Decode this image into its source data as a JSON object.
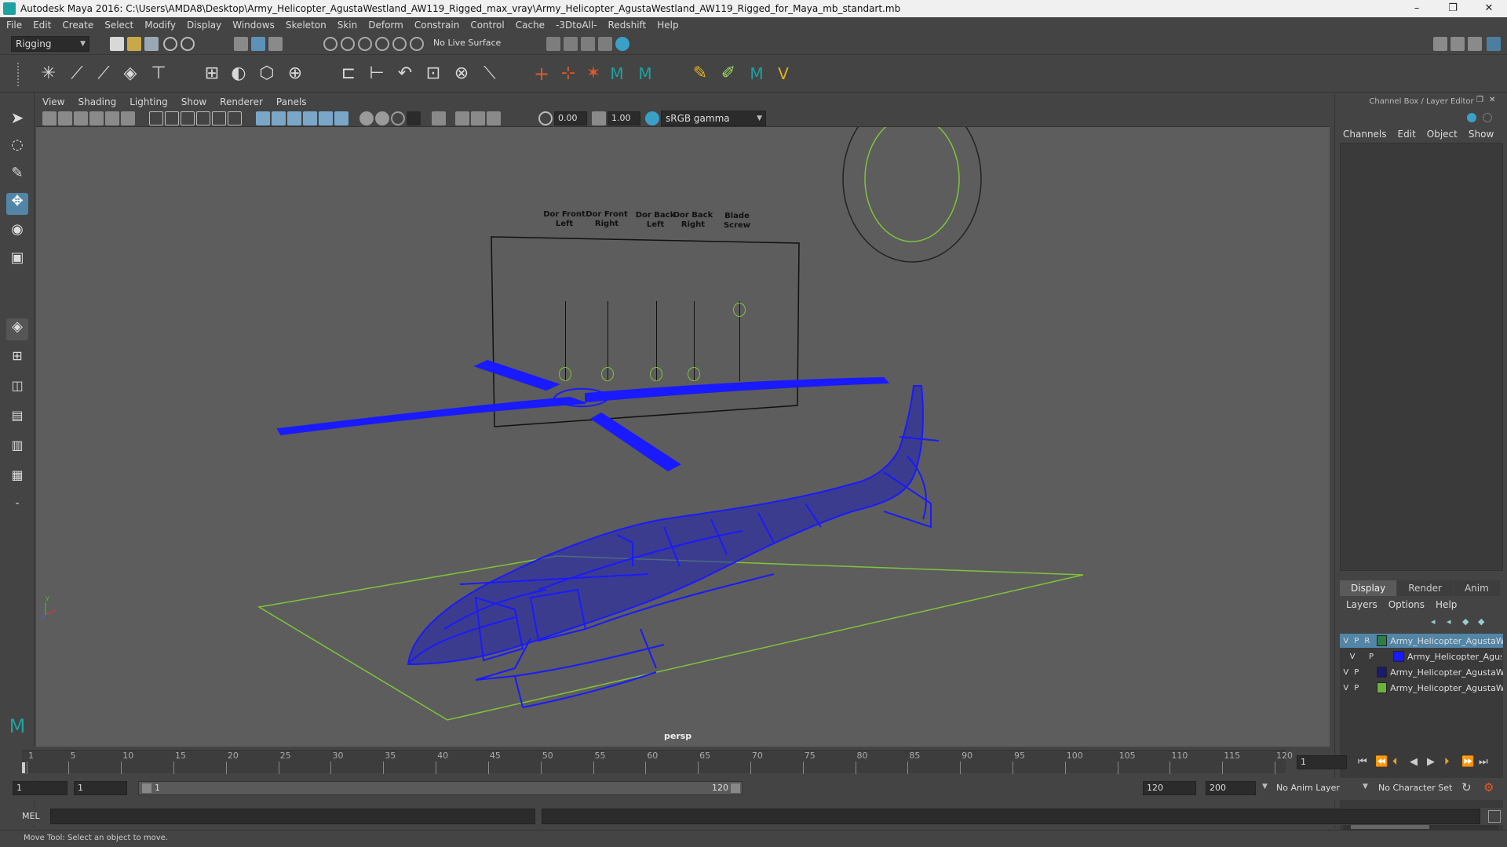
{
  "window": {
    "title": "Autodesk Maya 2016: C:\\Users\\AMDA8\\Desktop\\Army_Helicopter_AgustaWestland_AW119_Rigged_max_vray\\Army_Helicopter_AgustaWestland_AW119_Rigged_for_Maya_mb_standart.mb",
    "minimize": "–",
    "restore": "❐",
    "close": "✕"
  },
  "menubar": [
    "File",
    "Edit",
    "Create",
    "Select",
    "Modify",
    "Display",
    "Windows",
    "Skeleton",
    "Skin",
    "Deform",
    "Constrain",
    "Control",
    "Cache",
    "-3DtoAll-",
    "Redshift",
    "Help"
  ],
  "status_line": {
    "mode": "Rigging",
    "live_surface": "No Live Surface"
  },
  "panel_menu": [
    "View",
    "Shading",
    "Lighting",
    "Show",
    "Renderer",
    "Panels"
  ],
  "panel_toolbar": {
    "exposure": "0.00",
    "gamma": "1.00",
    "color_space": "sRGB gamma"
  },
  "viewport": {
    "camera_label": "persp",
    "controls": [
      "Dor Front Left",
      "Dor Front Right",
      "Dor Back Left",
      "Dor Back Right",
      "Blade Screw"
    ],
    "slider_levels": [
      0.1,
      0.1,
      0.1,
      0.1,
      0.9
    ],
    "wire_color": "#1a1aff",
    "control_color": "#7fc43a"
  },
  "channel_box": {
    "title": "Channel Box / Layer Editor",
    "menu": [
      "Channels",
      "Edit",
      "Object",
      "Show"
    ],
    "tabs": [
      "Display",
      "Render",
      "Anim"
    ],
    "active_tab": "Display",
    "layer_menu": [
      "Layers",
      "Options",
      "Help"
    ],
    "layers": [
      {
        "v": "V",
        "p": "P",
        "r": "R",
        "color": "#2e7d44",
        "name": "Army_Helicopter_AgustaWestland",
        "selected": true
      },
      {
        "v": "V",
        "p": "P",
        "r": "",
        "color": "#1a1aff",
        "name": "Army_Helicopter_AgustaWestland",
        "selected": false
      },
      {
        "v": "V",
        "p": "P",
        "r": "",
        "color": "#1a1a6e",
        "name": "Army_Helicopter_AgustaWestland",
        "selected": false
      },
      {
        "v": "V",
        "p": "P",
        "r": "",
        "color": "#6ab23c",
        "name": "Army_Helicopter_AgustaWestland",
        "selected": false
      }
    ]
  },
  "timeline": {
    "ticks": [
      1,
      5,
      10,
      15,
      20,
      25,
      30,
      35,
      40,
      45,
      50,
      55,
      60,
      65,
      70,
      75,
      80,
      85,
      90,
      95,
      100,
      105,
      110,
      115,
      120
    ],
    "current_frame": "1",
    "max": 120
  },
  "range": {
    "start": "1",
    "start_inner": "1",
    "slider_start": "1",
    "slider_end": "120",
    "end": "120",
    "end_outer": "200",
    "anim_layer": "No Anim Layer",
    "character_set": "No Character Set"
  },
  "command": {
    "label": "MEL"
  },
  "help_line": "Move Tool: Select an object to move."
}
